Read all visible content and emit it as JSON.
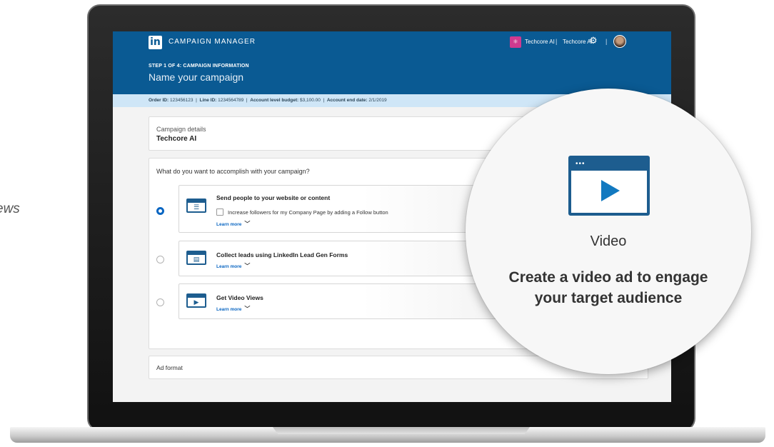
{
  "background_text": "ews",
  "header": {
    "logo_text": "in",
    "app_name": "CAMPAIGN MANAGER",
    "account_logo_glyph": "⚛",
    "account_name": "Techcore AI",
    "separator": "|",
    "account_name_secondary": "Techcore AI",
    "gear_icon_glyph": "⚙"
  },
  "step": {
    "label": "STEP 1 OF 4: CAMPAIGN INFORMATION",
    "title": "Name your campaign"
  },
  "info_bar": {
    "order_id_label": "Order ID:",
    "order_id": "123456123",
    "line_id_label": "Line ID:",
    "line_id": "1234564789",
    "budget_label": "Account level budget:",
    "budget": "$3,100.00",
    "end_date_label": "Account end date:",
    "end_date": "2/1/2019",
    "separator": "|"
  },
  "campaign_details": {
    "label": "Campaign details",
    "value": "Techcore AI"
  },
  "objective": {
    "question": "What do you want to accomplish with your campaign?",
    "options": [
      {
        "title": "Send people to your website or content",
        "checkbox_label": "Increase followers for my Company Page by adding a Follow button",
        "learn_more": "Learn more",
        "icon": "website-icon",
        "icon_glyph": "☰",
        "selected": true
      },
      {
        "title": "Collect leads using LinkedIn Lead Gen Forms",
        "learn_more": "Learn more",
        "icon": "form-icon",
        "icon_glyph": "▤",
        "selected": false
      },
      {
        "title": "Get Video Views",
        "learn_more": "Learn more",
        "icon": "video-icon",
        "icon_glyph": "▶",
        "selected": false
      }
    ],
    "chevron_glyph": "﹀"
  },
  "ad_format": {
    "label": "Ad format"
  },
  "bubble": {
    "icon": "video-player-icon",
    "icon_dots": "•••",
    "label": "Video",
    "description": "Create a video ad to engage your target audience"
  },
  "colors": {
    "header_blue": "#0a5a93",
    "info_bar": "#cfe6f7",
    "accent": "#0a66c2",
    "icon_blue": "#1d5d8f"
  }
}
